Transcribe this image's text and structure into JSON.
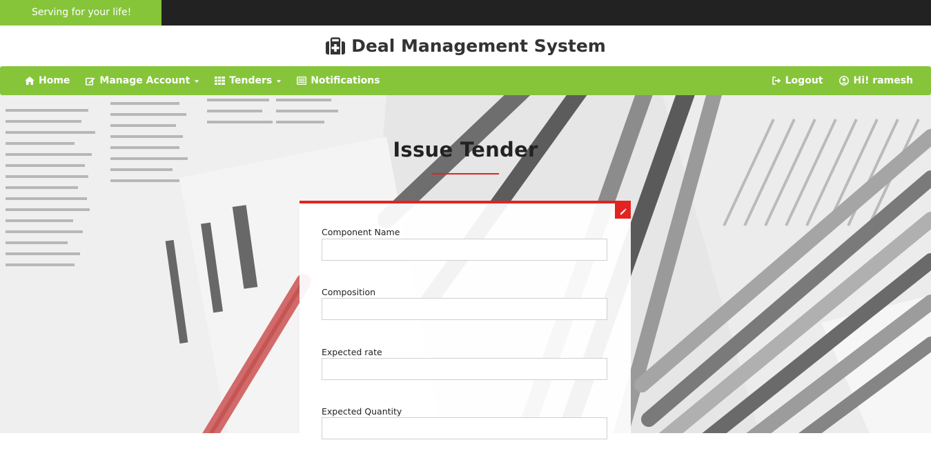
{
  "topbar": {
    "tagline": "Serving for your life!"
  },
  "brand": {
    "title": "Deal Management System",
    "icon": "medkit-icon"
  },
  "nav": {
    "left": [
      {
        "label": "Home",
        "icon": "home-icon",
        "dropdown": false
      },
      {
        "label": "Manage Account",
        "icon": "edit-icon",
        "dropdown": true
      },
      {
        "label": "Tenders",
        "icon": "grid-icon",
        "dropdown": true
      },
      {
        "label": "Notifications",
        "icon": "list-icon",
        "dropdown": false
      }
    ],
    "right": [
      {
        "label": "Logout",
        "icon": "logout-icon"
      },
      {
        "label": "Hi! ramesh",
        "icon": "user-circle-icon"
      }
    ]
  },
  "page": {
    "title": "Issue Tender"
  },
  "form": {
    "badge_icon": "pencil-icon",
    "fields": [
      {
        "label": "Component Name",
        "value": "",
        "placeholder": ""
      },
      {
        "label": "Composition",
        "value": "",
        "placeholder": ""
      },
      {
        "label": "Expected rate",
        "value": "",
        "placeholder": ""
      },
      {
        "label": "Expected Quantity",
        "value": "",
        "placeholder": ""
      }
    ]
  },
  "colors": {
    "accent_green": "#86c53a",
    "accent_red": "#e32222",
    "topbar_dark": "#222222"
  }
}
